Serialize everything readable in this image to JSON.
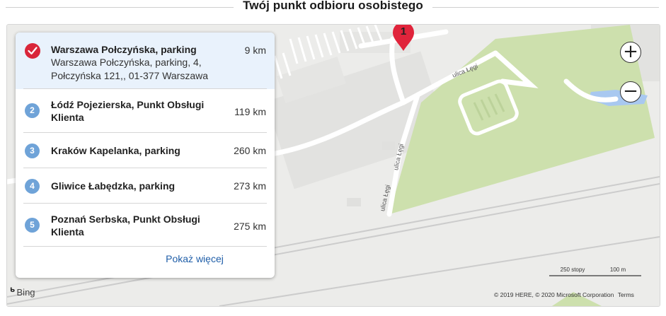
{
  "header": {
    "title": "Twój punkt odbioru osobistego"
  },
  "map": {
    "pin_label": "1",
    "street_label_1": "ulica Łęgi",
    "street_label_2": "ulica Łęgi",
    "street_label_3": "ulica Łęgi",
    "zoom_in": "+",
    "zoom_out": "−",
    "bing_label": "Bing",
    "scale_imperial": "250 stopy",
    "scale_metric": "100 m",
    "copyright": "© 2019 HERE, © 2020 Microsoft Corporation",
    "terms": "Terms"
  },
  "locations": [
    {
      "number": "1",
      "name": "Warszawa Połczyńska, parking",
      "address": "Warszawa Połczyńska, parking, 4, Połczyńska 121,, 01-377 Warszawa",
      "distance": "9 km",
      "selected": true
    },
    {
      "number": "2",
      "name": "Łódź Pojezierska, Punkt Obsługi Klienta",
      "distance": "119 km"
    },
    {
      "number": "3",
      "name": "Kraków Kapelanka, parking",
      "distance": "260 km"
    },
    {
      "number": "4",
      "name": "Gliwice Łabędzka, parking",
      "distance": "273 km"
    },
    {
      "number": "5",
      "name": "Poznań Serbska, Punkt Obsługi Klienta",
      "distance": "275 km"
    }
  ],
  "show_more": "Pokaż więcej",
  "colors": {
    "selected_bg": "#e9f2fc",
    "check_red": "#d9263a",
    "number_blue": "#6fa3d8",
    "link_blue": "#1f5ea8",
    "park_green": "#cde0ad"
  }
}
